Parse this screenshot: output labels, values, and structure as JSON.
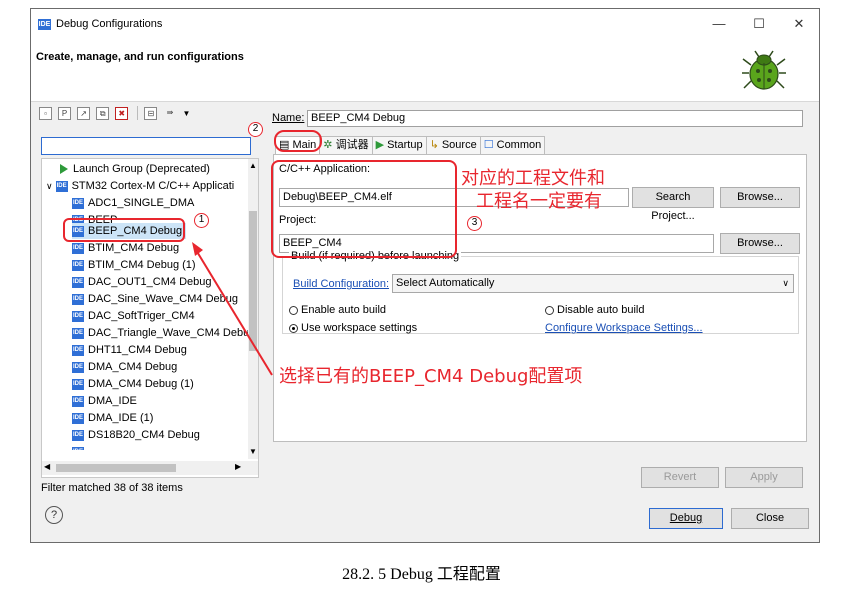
{
  "window": {
    "title": "Debug Configurations",
    "header_title": "Create, manage, and run configurations",
    "buttons": {
      "minimize": "—",
      "maximize": "☐",
      "close": "✕"
    },
    "icon_label": "IDE"
  },
  "toolbar": {
    "icons": [
      "new-config-icon",
      "new-prototype-icon",
      "export-icon",
      "duplicate-icon",
      "delete-icon",
      "collapse-all-icon",
      "filter-icon"
    ]
  },
  "tree": {
    "filter_value": "",
    "items": [
      {
        "label": "Launch Group (Deprecated)",
        "kind": "launch"
      },
      {
        "label": "STM32 Cortex-M C/C++ Applicati",
        "kind": "group",
        "expanded": true
      },
      {
        "label": "ADC1_SINGLE_DMA",
        "kind": "ide"
      },
      {
        "label": "BEEP",
        "kind": "ide"
      },
      {
        "label": "BEEP_CM4 Debug",
        "kind": "ide",
        "selected": true
      },
      {
        "label": "BTIM_CM4 Debug",
        "kind": "ide"
      },
      {
        "label": "BTIM_CM4 Debug (1)",
        "kind": "ide"
      },
      {
        "label": "DAC_OUT1_CM4 Debug",
        "kind": "ide"
      },
      {
        "label": "DAC_Sine_Wave_CM4 Debug",
        "kind": "ide"
      },
      {
        "label": "DAC_SoftTriger_CM4",
        "kind": "ide"
      },
      {
        "label": "DAC_Triangle_Wave_CM4 Debu",
        "kind": "ide"
      },
      {
        "label": "DHT11_CM4 Debug",
        "kind": "ide"
      },
      {
        "label": "DMA_CM4 Debug",
        "kind": "ide"
      },
      {
        "label": "DMA_CM4 Debug (1)",
        "kind": "ide"
      },
      {
        "label": "DMA_IDE",
        "kind": "ide"
      },
      {
        "label": "DMA_IDE (1)",
        "kind": "ide"
      },
      {
        "label": "DS18B20_CM4 Debug",
        "kind": "ide"
      }
    ],
    "filter_message": "Filter matched 38 of 38 items"
  },
  "config": {
    "name_label": "Name:",
    "name_value": "BEEP_CM4 Debug",
    "tabs": [
      "Main",
      "调试器",
      "Startup",
      "Source",
      "Common"
    ],
    "active_tab": "Main",
    "app_label": "C/C++ Application:",
    "app_value": "Debug\\BEEP_CM4.elf",
    "search_project_button": "Search Project...",
    "browse_button_1": "Browse...",
    "project_label": "Project:",
    "project_value": "BEEP_CM4",
    "browse_button_2": "Browse...",
    "build_group_label": "Build (if required) before launching",
    "build_config_link": "Build Configuration:",
    "build_config_value": "Select Automatically",
    "enable_auto_build": "Enable auto build",
    "disable_auto_build": "Disable auto build",
    "use_workspace_settings": "Use workspace settings",
    "configure_workspace_link": "Configure Workspace Settings...",
    "revert_button": "Revert",
    "apply_button": "Apply"
  },
  "footer": {
    "help": "?",
    "debug_button": "Debug",
    "close_button": "Close"
  },
  "annotations": {
    "note_main_line1": "对应的工程文件和",
    "note_main_line2": "工程名一定要有",
    "note_select": "选择已有的BEEP_CM4 Debug配置项",
    "marker_1": "1",
    "marker_2": "2",
    "marker_3": "3",
    "color": "#e8262e"
  },
  "caption": "28.2. 5 Debug 工程配置"
}
